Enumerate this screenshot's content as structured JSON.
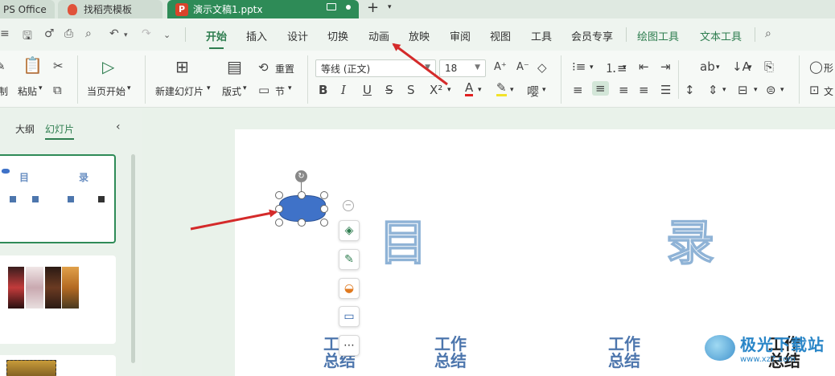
{
  "tabs": {
    "tab1_label": "PS Office",
    "tab2_label": "找稻壳模板",
    "tab3_label": "演示文稿1.pptx",
    "ppt_badge": "P"
  },
  "menu": {
    "items": [
      "开始",
      "插入",
      "设计",
      "切换",
      "动画",
      "放映",
      "审阅",
      "视图",
      "工具",
      "会员专享",
      "绘图工具",
      "文本工具"
    ],
    "active": "开始"
  },
  "ribbon": {
    "copy_label": "制",
    "paste_label": "粘贴",
    "play_label": "当页开始",
    "new_slide_label": "新建幻灯片",
    "layout_label": "版式",
    "reset_label": "重置",
    "section_label": "节",
    "font_family": "等线 (正文)",
    "font_size": "18",
    "shape_label": "形",
    "text_label": "文"
  },
  "left_panel": {
    "outline_tab": "大纲",
    "slides_tab": "幻灯片",
    "thumb1_texts": [
      "目",
      "录"
    ]
  },
  "slide": {
    "title_left": "目",
    "title_right": "录",
    "items": [
      {
        "l1": "工作",
        "l2": "总结"
      },
      {
        "l1": "工作",
        "l2": "总结"
      },
      {
        "l1": "工作",
        "l2": "总结"
      },
      {
        "l1": "工作",
        "l2": "总结"
      }
    ]
  },
  "watermark": {
    "text": "极光下载站",
    "url": "www.xz7.com"
  },
  "colors": {
    "accent": "#2e7d4f",
    "tab_active": "#2e8b57",
    "shape_fill": "#3f72c8",
    "arrow": "#d42a2a"
  },
  "float_toolbar_icons": [
    "minus-icon",
    "layers-icon",
    "brush-icon",
    "fill-icon",
    "monitor-icon",
    "more-icon"
  ]
}
